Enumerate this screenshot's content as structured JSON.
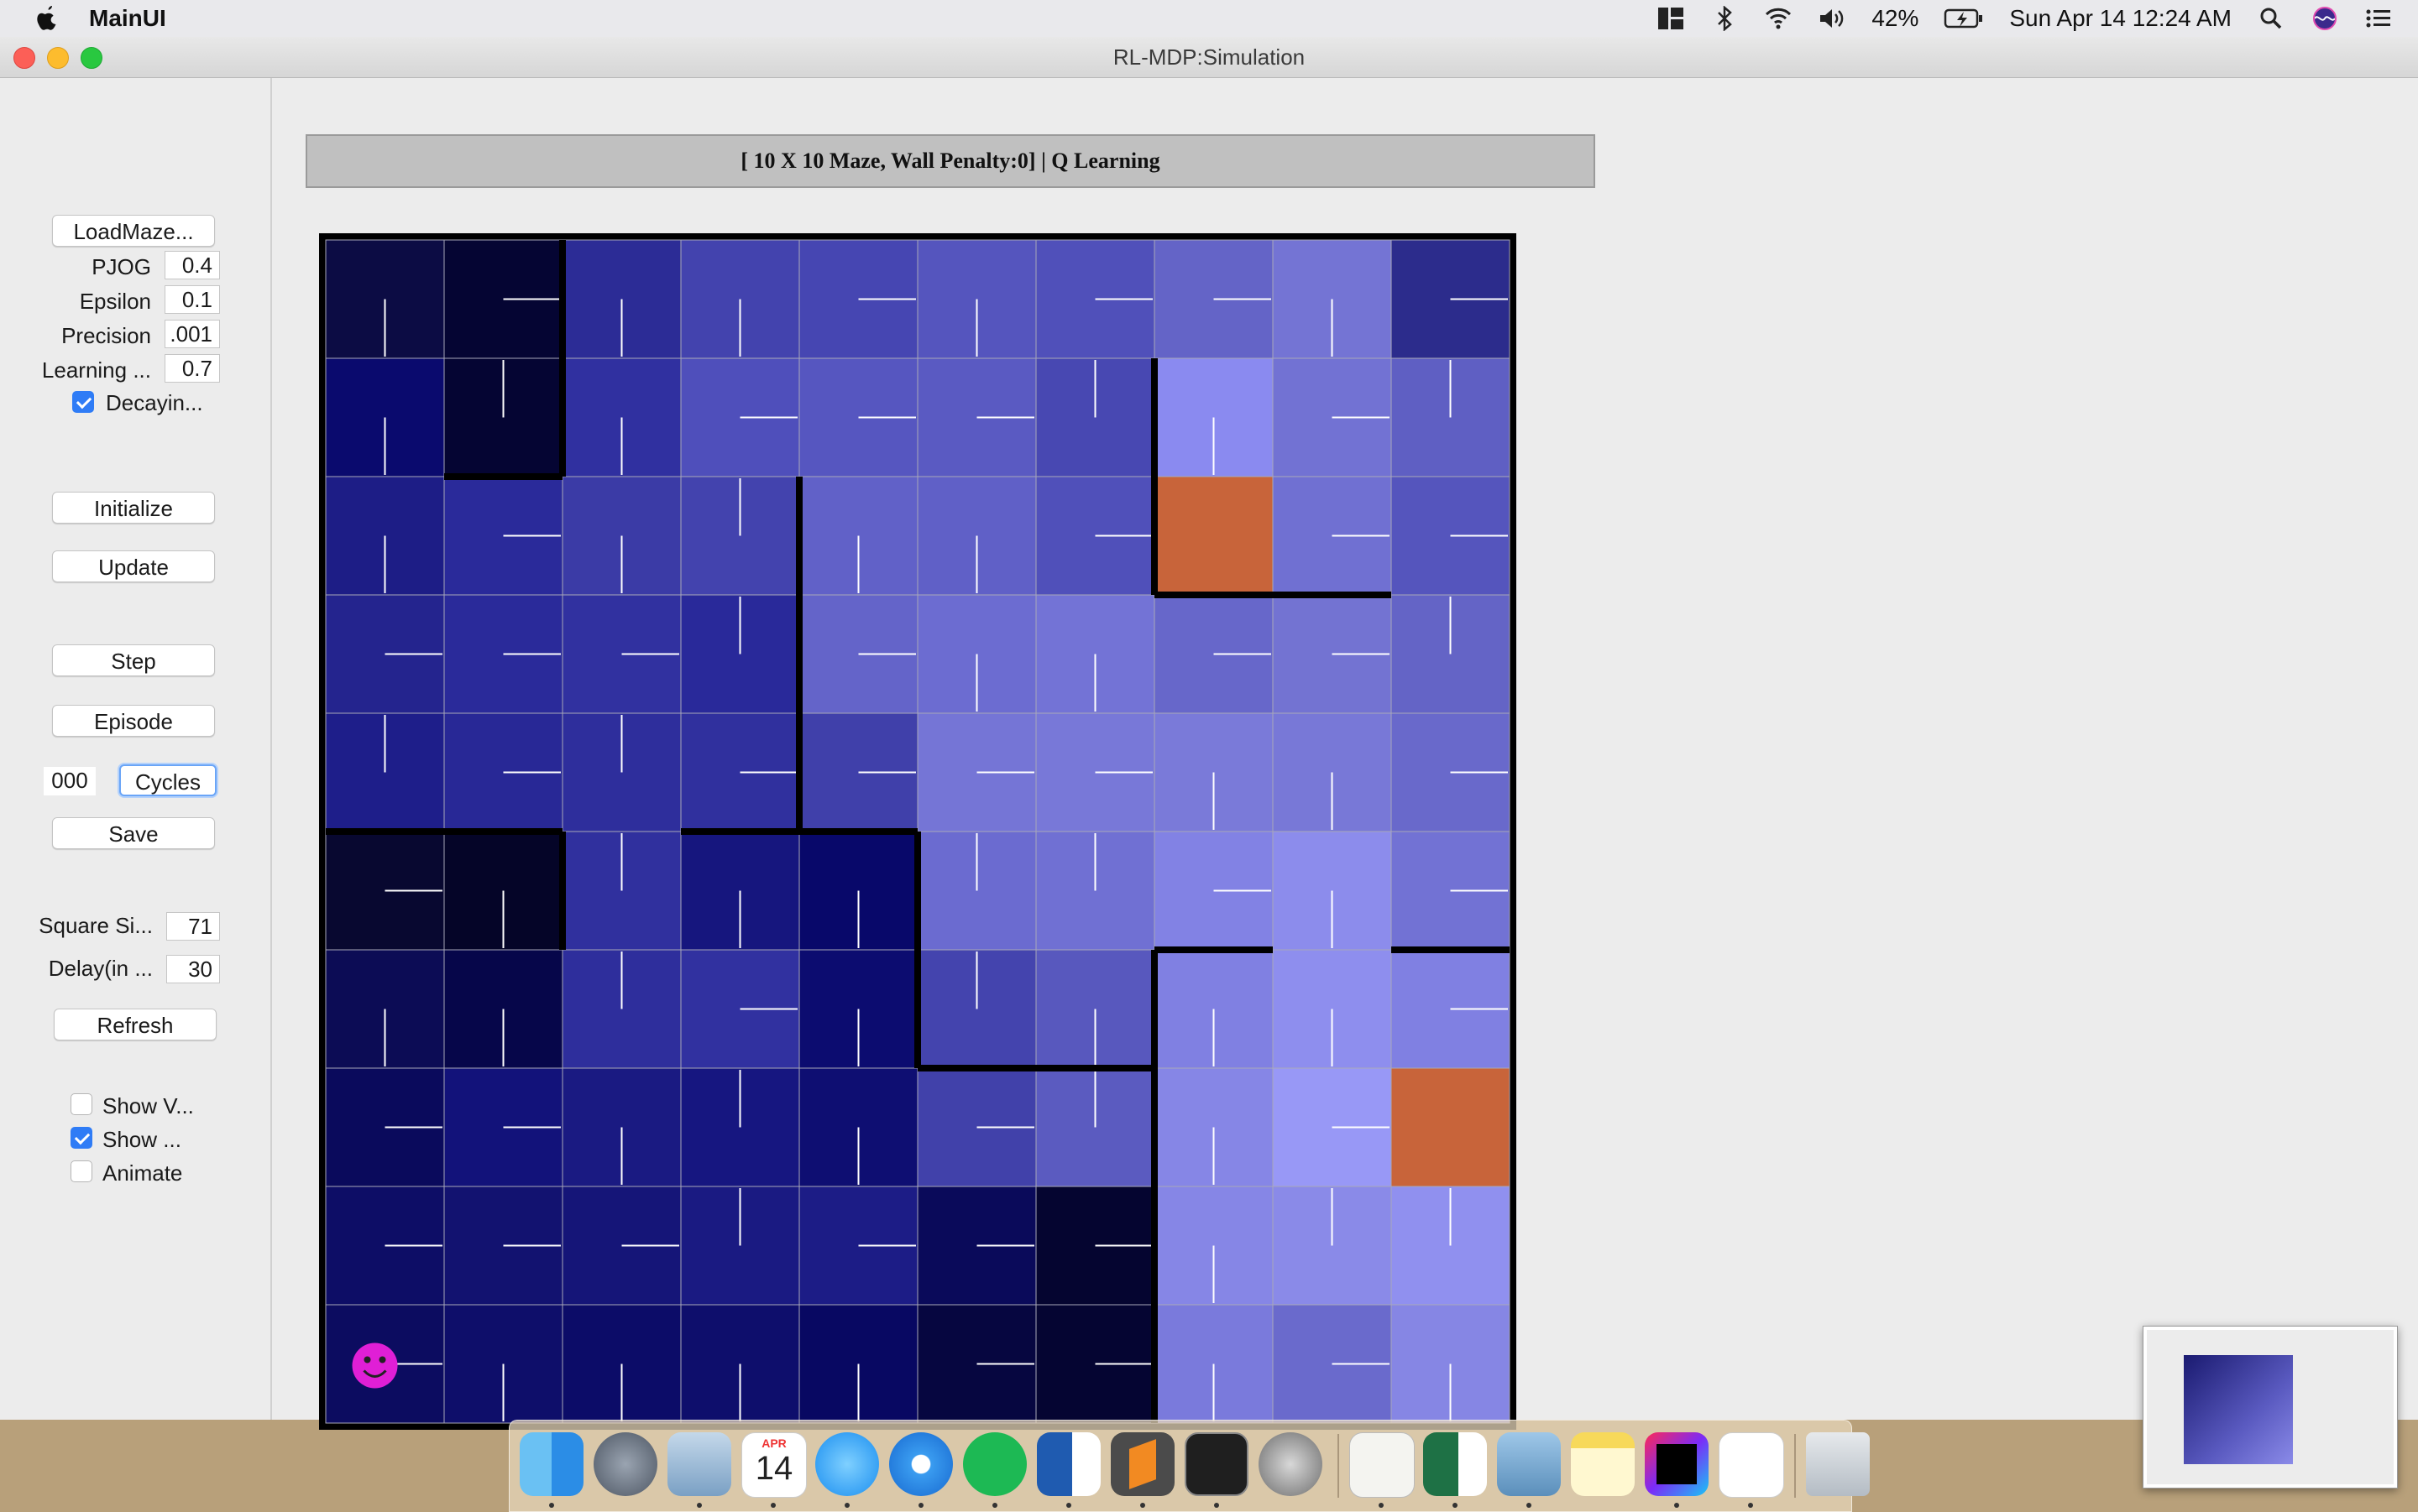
{
  "menubar": {
    "app_name": "MainUI",
    "battery": "42%",
    "clock": "Sun Apr 14  12:24 AM",
    "icons": [
      "apple-icon",
      "layout-icon",
      "bluetooth-icon",
      "wifi-icon",
      "volume-icon",
      "battery-icon",
      "search-icon",
      "siri-icon",
      "notification-list-icon"
    ]
  },
  "window": {
    "title": "RL-MDP:Simulation"
  },
  "sidebar": {
    "load_maze": "LoadMaze...",
    "pjog_label": "PJOG",
    "pjog_value": "0.4",
    "epsilon_label": "Epsilon",
    "epsilon_value": "0.1",
    "precision_label": "Precision",
    "precision_value": ".001",
    "learning_label": "Learning ...",
    "learning_value": "0.7",
    "decaying_label": "Decayin...",
    "decaying_checked": true,
    "initialize": "Initialize",
    "update": "Update",
    "step": "Step",
    "episode": "Episode",
    "cycles_value": "000",
    "cycles": "Cycles",
    "save": "Save",
    "square_size_label": "Square Si...",
    "square_size_value": "71",
    "delay_label": "Delay(in ...",
    "delay_value": "30",
    "refresh": "Refresh",
    "show_v_label": "Show V...",
    "show_v_checked": false,
    "show_label": "Show ...",
    "show_checked": true,
    "animate_label": "Animate",
    "animate_checked": false
  },
  "header": {
    "text": "[ 10 X 10 Maze, Wall Penalty:0] |  Q Learning"
  },
  "maze": {
    "rows": 10,
    "cols": 10,
    "goal_color": "#c8643a",
    "agent_color": "#e01fd6",
    "goals": [
      [
        2,
        7
      ],
      [
        7,
        9
      ]
    ],
    "agent": [
      9,
      0
    ],
    "colors": [
      [
        "#0c0c44",
        "#050533",
        "#2c2c96",
        "#4343ae",
        "#4646b2",
        "#5555be",
        "#5050ba",
        "#6464c7",
        "#7474d4",
        "#2c2c8c"
      ],
      [
        "#0a0a6e",
        "#050533",
        "#3030a0",
        "#4f4fbb",
        "#5656c0",
        "#5a5ac2",
        "#4848b2",
        "#8a8af0",
        "#7272d3",
        "#5f5fc3"
      ],
      [
        "#1d1d86",
        "#2a2a9a",
        "#3b3ba6",
        "#4343ae",
        "#6161c8",
        "#6060c7",
        "#5050ba",
        "#c8643a",
        "#7070d2",
        "#5555bd"
      ],
      [
        "#24248e",
        "#2a2a9a",
        "#3131a0",
        "#29299a",
        "#6464c9",
        "#6c6cd1",
        "#7373d6",
        "#6767ca",
        "#7373d2",
        "#6464c6"
      ],
      [
        "#1e1e8a",
        "#282896",
        "#2e2e9c",
        "#30309e",
        "#4040aa",
        "#7575d6",
        "#7878d8",
        "#7a7ad9",
        "#7878d7",
        "#6969cb"
      ],
      [
        "#080830",
        "#050528",
        "#30309e",
        "#16167e",
        "#08086a",
        "#6b6bd0",
        "#7070d3",
        "#8282e4",
        "#8c8cec",
        "#7272d4"
      ],
      [
        "#0c0c55",
        "#06064a",
        "#2e2e9c",
        "#3131a0",
        "#0c0c70",
        "#4444ae",
        "#5858be",
        "#8080e2",
        "#8e8eee",
        "#8080e2"
      ],
      [
        "#0a0a5c",
        "#12127a",
        "#1a1a82",
        "#161680",
        "#0e0e72",
        "#4141aa",
        "#5b5bc0",
        "#8686e6",
        "#9898f6",
        "#c8643a"
      ],
      [
        "#0d0d66",
        "#121270",
        "#151578",
        "#1a1a82",
        "#1c1c86",
        "#0a0a5a",
        "#050530",
        "#8686e6",
        "#8a8ae8",
        "#9090ef"
      ],
      [
        "#0c0c60",
        "#0e0e6a",
        "#0c0c68",
        "#0e0e6c",
        "#080862",
        "#060640",
        "#050532",
        "#7a7adc",
        "#6a6acc",
        "#8686e4"
      ]
    ],
    "policy": [
      [
        "down",
        "right",
        "down",
        "down",
        "right",
        "down",
        "right",
        "right",
        "down",
        "right"
      ],
      [
        "down",
        "up",
        "down",
        "right",
        "right",
        "right",
        "up",
        "down",
        "right",
        "up"
      ],
      [
        "down",
        "right",
        "down",
        "up",
        "down",
        "down",
        "right",
        "none",
        "right",
        "right"
      ],
      [
        "right",
        "right",
        "right",
        "up",
        "right",
        "down",
        "down",
        "right",
        "right",
        "up"
      ],
      [
        "up",
        "right",
        "up",
        "right",
        "right",
        "right",
        "right",
        "down",
        "down",
        "right"
      ],
      [
        "right",
        "down",
        "up",
        "down",
        "down",
        "up",
        "up",
        "right",
        "down",
        "right"
      ],
      [
        "down",
        "down",
        "up",
        "right",
        "down",
        "up",
        "down",
        "down",
        "down",
        "right"
      ],
      [
        "right",
        "right",
        "down",
        "up",
        "down",
        "right",
        "up",
        "down",
        "right",
        "none"
      ],
      [
        "right",
        "right",
        "right",
        "up",
        "right",
        "right",
        "right",
        "down",
        "up",
        "up"
      ],
      [
        "right",
        "down",
        "down",
        "down",
        "down",
        "right",
        "right",
        "down",
        "right",
        "down"
      ]
    ]
  },
  "dock": {
    "apps": [
      "finder-icon",
      "launchpad-icon",
      "eagle-app-icon",
      "calendar-icon",
      "messages-icon",
      "safari-icon",
      "spotify-icon",
      "word-icon",
      "sublime-icon",
      "terminal-icon",
      "system-preferences-icon",
      "notes-paper-icon",
      "excel-icon",
      "preview-icon",
      "notes-icon",
      "intellij-icon",
      "java-icon",
      "trash-icon"
    ],
    "calendar_month": "APR",
    "calendar_day": "14"
  }
}
